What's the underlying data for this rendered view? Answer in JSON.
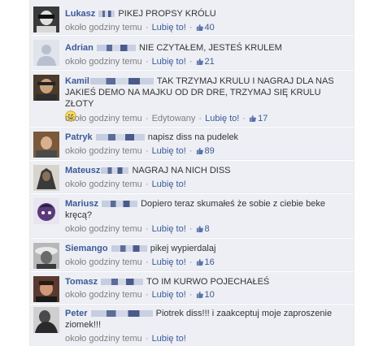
{
  "comments": [
    {
      "author": "Lukasz",
      "text": "PIKEJ PROPSY KRÓLU",
      "time": "około godziny temu",
      "like": "Lubię to!",
      "likes": "40"
    },
    {
      "author": "Adrian",
      "text": "NIE CZYTAŁEM, JESTEŚ KRULEM",
      "time": "około godziny temu",
      "like": "Lubię to!",
      "likes": "21"
    },
    {
      "author": "Kamil",
      "text": "TAK TRZYMAJ KRULU I NAGRAJ DLA NAS JAKIEŚ DEMO NA MAJKU OD DR DRE, TRZYMAJ SIĘ KRULU ZŁOTY",
      "time": "około godziny temu",
      "edited": "Edytowany",
      "like": "Lubię to!",
      "likes": "17"
    },
    {
      "author": "Patryk",
      "text": "napisz diss na pudelek",
      "time": "około godziny temu",
      "like": "Lubię to!",
      "likes": "89"
    },
    {
      "author": "Mateusz",
      "text": "NAGRAJ NA NICH DISS",
      "time": "około godziny temu",
      "like": "Lubię to!",
      "likes": ""
    },
    {
      "author": "Mariusz",
      "text": "Dopiero teraz skumałeś że sobie z ciebie beke kręcą?",
      "time": "około godziny temu",
      "like": "Lubię to!",
      "likes": "8"
    },
    {
      "author": "Siemango",
      "text": "pikej wypierdalaj",
      "time": "około godziny temu",
      "like": "Lubię to!",
      "likes": "16"
    },
    {
      "author": "Tomasz",
      "text": "TO IM KURWO POJECHAŁEŚ",
      "time": "około godziny temu",
      "like": "Lubię to!",
      "likes": "10"
    },
    {
      "author": "Peter",
      "text": "Piotrek diss!!! i zaakceptuj moje zaproszenie ziomek!!!",
      "time": "około godziny temu",
      "like": "Lubię to!",
      "likes": ""
    }
  ],
  "colors": {
    "link": "#3b5998",
    "meta": "#808080",
    "row_bg": "#edeff4"
  },
  "icons": {
    "like": "thumbs-up-icon",
    "smiley": "smiley-icon"
  }
}
